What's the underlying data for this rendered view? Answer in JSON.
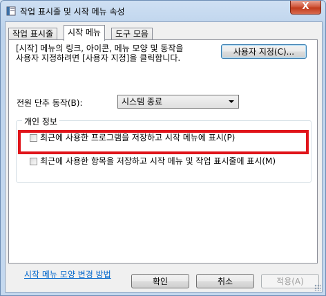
{
  "window": {
    "title": "작업 표시줄 및 시작 메뉴 속성",
    "close_glyph": "X"
  },
  "tabs": [
    {
      "label": "작업 표시줄",
      "active": false
    },
    {
      "label": "시작 메뉴",
      "active": true
    },
    {
      "label": "도구 모음",
      "active": false
    }
  ],
  "start_menu": {
    "description_line1": "[시작] 메뉴의 링크, 아이콘, 메뉴 모양 및 동작을",
    "description_line2": "사용자 지정하려면 [사용자 지정]을 클릭합니다.",
    "customize_button": "사용자 지정(C)...",
    "power_label": "전원 단추 동작(B):",
    "power_value": "시스템 종료",
    "privacy": {
      "title": "개인 정보",
      "store_programs": {
        "label": "최근에 사용한 프로그램을 저장하고 시작 메뉴에 표시(P)",
        "checked": false
      },
      "store_items": {
        "label": "최근에 사용한 항목을 저장하고 시작 메뉴 및 작업 표시줄에 표시(M)",
        "checked": false
      }
    },
    "help_link": "시작 메뉴 모양 변경 방법"
  },
  "footer": {
    "ok": "확인",
    "cancel": "취소",
    "apply": "적용(A)"
  },
  "colors": {
    "highlight": "#e0141a",
    "link": "#0066cc",
    "close": "#c13b1c"
  }
}
